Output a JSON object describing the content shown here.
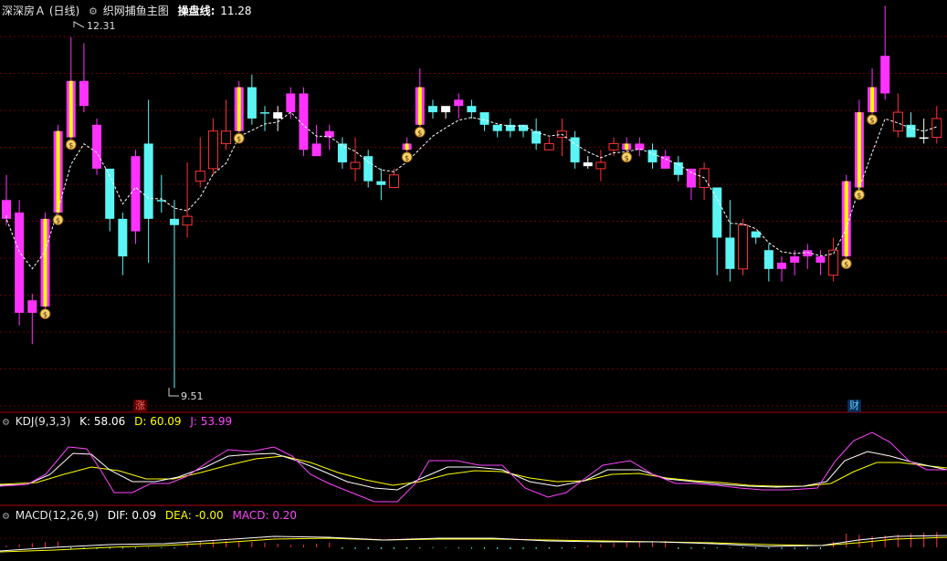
{
  "main": {
    "stock": "深深房Ａ (日线)",
    "indicator": "织网捕鱼主图",
    "line_label": "操盘线:",
    "line_value": "11.28",
    "high_label": "12.31",
    "low_label": "9.51",
    "marker_zhang": "涨",
    "marker_cai": "财",
    "colors": {
      "up_yellow": "#ffff00",
      "down_cyan": "#5cf5f5",
      "up_magenta": "#ff33ff",
      "down_red": "#ff3333",
      "grid": "#7a0000"
    }
  },
  "kdj": {
    "title": "KDJ(9,3,3)",
    "k": "K: 58.06",
    "d": "D: 60.09",
    "j": "J: 53.99"
  },
  "macd": {
    "title": "MACD(12,26,9)",
    "dif": "DIF: 0.09",
    "dea": "DEA: -0.00",
    "macd": "MACD: 0.20"
  },
  "chart_data": {
    "type": "candlestick",
    "price_range": [
      9.4,
      12.5
    ],
    "high_marker": 12.31,
    "low_marker": 9.51,
    "candles": [
      [
        11.05,
        10.9,
        11.25,
        10.85,
        "m"
      ],
      [
        10.95,
        10.15,
        11.05,
        10.05,
        "m"
      ],
      [
        10.15,
        10.25,
        10.3,
        9.9,
        "m"
      ],
      [
        10.2,
        10.9,
        10.95,
        10.15,
        "y"
      ],
      [
        10.95,
        11.6,
        11.65,
        10.9,
        "y"
      ],
      [
        11.55,
        12.0,
        12.35,
        11.5,
        "y"
      ],
      [
        12.0,
        11.8,
        12.3,
        11.75,
        "m"
      ],
      [
        11.65,
        11.3,
        11.7,
        11.25,
        "m"
      ],
      [
        11.3,
        10.9,
        11.3,
        10.8,
        "c"
      ],
      [
        10.9,
        10.6,
        10.95,
        10.45,
        "c"
      ],
      [
        10.8,
        11.4,
        11.45,
        10.7,
        "m"
      ],
      [
        11.5,
        10.9,
        11.85,
        10.55,
        "c"
      ],
      [
        11.05,
        11.05,
        11.25,
        10.95,
        "c"
      ],
      [
        10.9,
        10.85,
        11.05,
        9.55,
        "c"
      ],
      [
        10.85,
        10.92,
        11.35,
        10.75,
        "o"
      ],
      [
        11.2,
        11.28,
        11.55,
        11.15,
        "o"
      ],
      [
        11.3,
        11.6,
        11.7,
        11.25,
        "o"
      ],
      [
        11.6,
        11.5,
        11.85,
        11.45,
        "o"
      ],
      [
        11.6,
        11.95,
        12.0,
        11.55,
        "y"
      ],
      [
        11.95,
        11.7,
        12.05,
        11.65,
        "c"
      ],
      [
        11.75,
        11.75,
        11.8,
        11.6,
        "c"
      ],
      [
        11.75,
        11.7,
        11.8,
        11.6,
        "w"
      ],
      [
        11.75,
        11.9,
        11.95,
        11.7,
        "m"
      ],
      [
        11.9,
        11.45,
        11.95,
        11.4,
        "m"
      ],
      [
        11.5,
        11.4,
        11.65,
        11.4,
        "m"
      ],
      [
        11.6,
        11.55,
        11.65,
        11.45,
        "m"
      ],
      [
        11.5,
        11.35,
        11.55,
        11.3,
        "c"
      ],
      [
        11.3,
        11.35,
        11.55,
        11.2,
        "o"
      ],
      [
        11.4,
        11.2,
        11.45,
        11.15,
        "c"
      ],
      [
        11.2,
        11.17,
        11.3,
        11.05,
        "c"
      ],
      [
        11.15,
        11.25,
        11.3,
        11.15,
        "o"
      ],
      [
        11.45,
        11.5,
        11.55,
        11.4,
        "y"
      ],
      [
        11.95,
        11.65,
        12.1,
        11.6,
        "y"
      ],
      [
        11.8,
        11.75,
        11.85,
        11.7,
        "c"
      ],
      [
        11.8,
        11.75,
        11.8,
        11.7,
        "w"
      ],
      [
        11.85,
        11.8,
        11.9,
        11.7,
        "m"
      ],
      [
        11.8,
        11.75,
        11.85,
        11.7,
        "c"
      ],
      [
        11.75,
        11.65,
        11.75,
        11.6,
        "c"
      ],
      [
        11.65,
        11.6,
        11.65,
        11.55,
        "c"
      ],
      [
        11.65,
        11.6,
        11.7,
        11.55,
        "c"
      ],
      [
        11.6,
        11.65,
        11.65,
        11.55,
        "c"
      ],
      [
        11.6,
        11.5,
        11.7,
        11.45,
        "c"
      ],
      [
        11.45,
        11.5,
        11.55,
        11.45,
        "o"
      ],
      [
        11.55,
        11.6,
        11.7,
        11.4,
        "o"
      ],
      [
        11.55,
        11.35,
        11.6,
        11.3,
        "c"
      ],
      [
        11.35,
        11.32,
        11.4,
        11.3,
        "w"
      ],
      [
        11.35,
        11.3,
        11.45,
        11.2,
        "o"
      ],
      [
        11.45,
        11.5,
        11.55,
        11.4,
        "o"
      ],
      [
        11.5,
        11.45,
        11.55,
        11.4,
        "y"
      ],
      [
        11.45,
        11.5,
        11.55,
        11.4,
        "m"
      ],
      [
        11.45,
        11.35,
        11.5,
        11.3,
        "c"
      ],
      [
        11.4,
        11.3,
        11.45,
        11.3,
        "m"
      ],
      [
        11.35,
        11.25,
        11.4,
        11.2,
        "c"
      ],
      [
        11.3,
        11.15,
        11.3,
        11.05,
        "m"
      ],
      [
        11.3,
        11.15,
        11.35,
        11.05,
        "o"
      ],
      [
        11.15,
        10.75,
        11.15,
        10.45,
        "c"
      ],
      [
        10.75,
        10.5,
        11.05,
        10.4,
        "c"
      ],
      [
        10.5,
        10.85,
        10.9,
        10.45,
        "o"
      ],
      [
        10.8,
        10.75,
        10.8,
        10.7,
        "c"
      ],
      [
        10.65,
        10.5,
        10.7,
        10.4,
        "c"
      ],
      [
        10.55,
        10.5,
        10.6,
        10.4,
        "m"
      ],
      [
        10.55,
        10.6,
        10.65,
        10.45,
        "m"
      ],
      [
        10.6,
        10.65,
        10.7,
        10.5,
        "m"
      ],
      [
        10.6,
        10.55,
        10.65,
        10.45,
        "m"
      ],
      [
        10.45,
        10.65,
        10.75,
        10.4,
        "o"
      ],
      [
        10.6,
        11.2,
        11.25,
        10.55,
        "y"
      ],
      [
        11.15,
        11.75,
        11.85,
        11.1,
        "y"
      ],
      [
        11.75,
        11.95,
        12.1,
        11.7,
        "y"
      ],
      [
        11.9,
        12.2,
        12.6,
        11.85,
        "m"
      ],
      [
        11.75,
        11.6,
        11.9,
        11.55,
        "o"
      ],
      [
        11.65,
        11.55,
        11.75,
        11.55,
        "c"
      ],
      [
        11.55,
        11.55,
        11.7,
        11.5,
        "w"
      ],
      [
        11.55,
        11.7,
        11.8,
        11.5,
        "o"
      ]
    ]
  }
}
